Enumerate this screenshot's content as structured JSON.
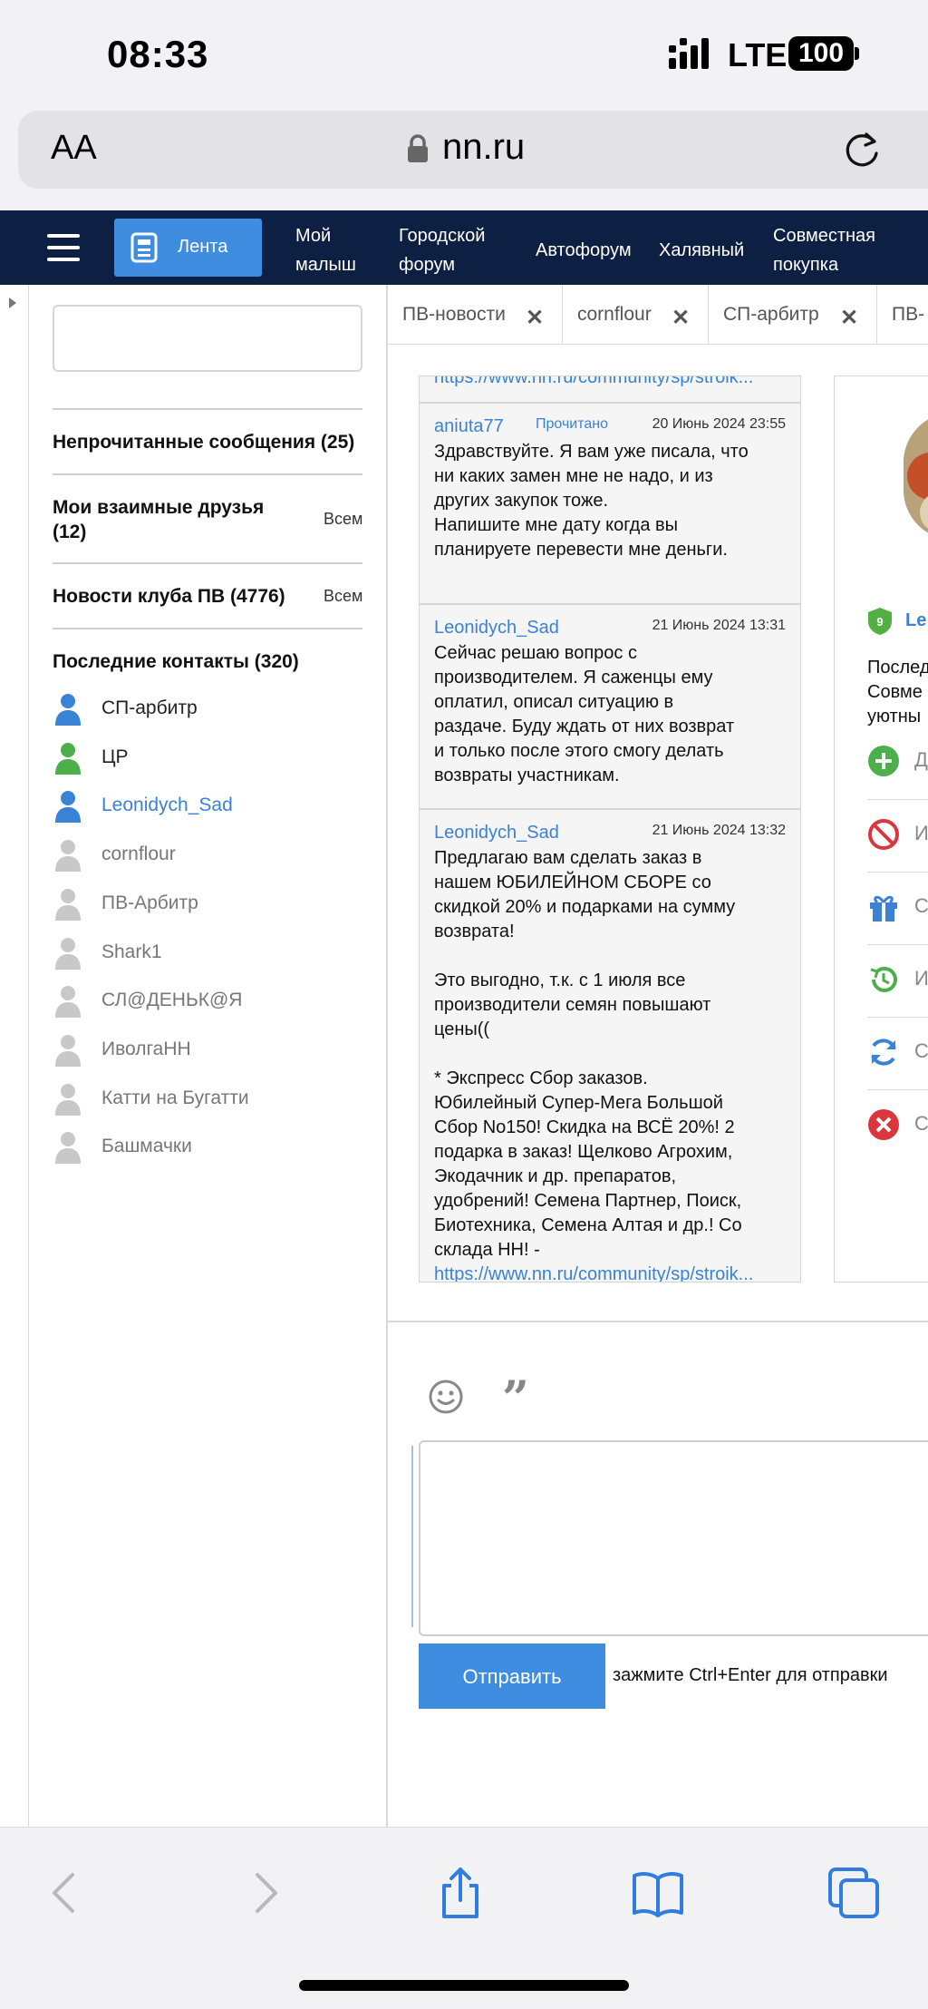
{
  "status_bar": {
    "time": "08:33",
    "network": "LTE",
    "battery": "100"
  },
  "browser": {
    "text_size_label": "AA",
    "domain": "nn.ru"
  },
  "site_nav": {
    "active": "Лента",
    "items": [
      "Мой\nмалыш",
      "Городской\nфорум",
      "Автофорум",
      "Халявный",
      "Совместная\nпокупка"
    ]
  },
  "sidebar": {
    "unread": "Непрочитанные сообщения (25)",
    "friends": "Мои взаимные друзья\n(12)",
    "friends_all": "Всем",
    "club_news": "Новости клуба ПВ (4776)",
    "club_news_all": "Всем",
    "recent_contacts": "Последние контакты (320)",
    "contacts": [
      {
        "name": "СП-арбитр",
        "status": "blue"
      },
      {
        "name": "ЦР",
        "status": "green"
      },
      {
        "name": "Leonidych_Sad",
        "status": "blue"
      },
      {
        "name": "cornflour",
        "status": "gray"
      },
      {
        "name": "ПВ-Арбитр",
        "status": "gray"
      },
      {
        "name": "Shark1",
        "status": "gray"
      },
      {
        "name": "СЛ@ДЕНЬК@Я",
        "status": "gray"
      },
      {
        "name": "ИволгаНН",
        "status": "gray"
      },
      {
        "name": "Катти на Бугатти",
        "status": "gray"
      },
      {
        "name": "Башмачки",
        "status": "gray"
      }
    ]
  },
  "tabs": [
    "ПВ-новости",
    "cornflour",
    "СП-арбитр",
    "ПВ-"
  ],
  "chat": {
    "prev_link_fragment": "https://www.nn.ru/community/sp/stroik...",
    "messages": [
      {
        "author": "aniuta77",
        "read": "Прочитано",
        "date": "20 Июнь 2024 23:55",
        "text": "Здравствуйте. Я вам уже писала, что\nни каких замен мне не надо, и из\nдругих закупок тоже.\nНапишите мне дату когда вы\nпланируете перевести мне деньги."
      },
      {
        "author": "Leonidych_Sad",
        "read": "",
        "date": "21 Июнь 2024 13:31",
        "text": "Сейчас решаю вопрос с\nпроизводителем. Я саженцы ему\nоплатил, описал ситуацию в\nраздаче. Буду ждать от них возврат\nи только после этого смогу делать\nвозвраты участникам."
      },
      {
        "author": "Leonidych_Sad",
        "read": "",
        "date": "21 Июнь 2024 13:32",
        "text": "Предлагаю вам сделать заказ в\nнашем ЮБИЛЕЙНОМ СБОРЕ со\nскидкой 20% и подарками на сумму\nвозврата!\n\nЭто выгодно, т.к. с 1 июля все\nпроизводители семян повышают\nцены((\n\n* Экспресс Сбор заказов.\nЮбилейный Супер-Мега Большой\nСбор No150! Скидка на ВСЁ 20%! 2\nподарка в заказ! Щелково Агрохим,\nЭкодачник и др. препаратов,\nудобрений! Семена Партнер, Поиск,\nБиотехника, Семена Алтая и др.! Со\nсклада НН! -",
        "link": "https://www.nn.ru/community/sp/stroik..."
      }
    ]
  },
  "profile": {
    "level": "9",
    "name_fragment": "Le",
    "text_fragment": "Послед\nСовме\nуютны",
    "action_fragments": [
      "Д",
      "И",
      "С",
      "И",
      "С",
      "С"
    ]
  },
  "composer": {
    "send_label": "Отправить",
    "hint": "зажмите Ctrl+Enter для отправки"
  }
}
